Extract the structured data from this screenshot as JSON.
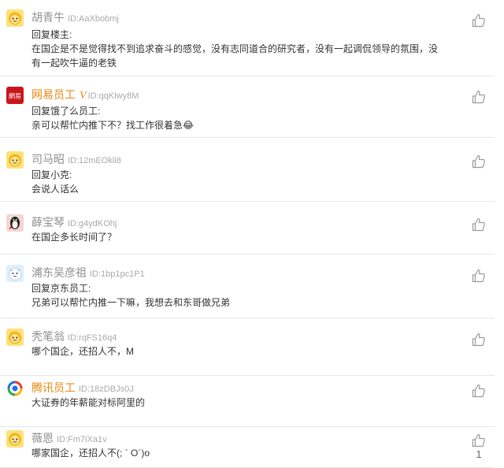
{
  "comments": [
    {
      "name": "胡青牛",
      "id": "ID:AaXbobmj",
      "avatar": "yellow-face",
      "official": false,
      "lines": [
        "回复楼主:",
        "在国企是不是觉得找不到追求奋斗的感觉，没有志同道合的研究者，没有一起调侃领导的氛围，没",
        "有一起吹牛逼的老铁"
      ]
    },
    {
      "name": "网易员工",
      "verified": "V",
      "id": "ID:qqKlwy8M",
      "avatar": "netease-logo",
      "avatar_text": "網易",
      "official": true,
      "lines": [
        "回复饿了么员工:",
        "亲可以帮忙内推下不？找工作很着急😂"
      ]
    },
    {
      "name": "司马昭",
      "id": "ID:12mEOkli8",
      "avatar": "yellow-face",
      "official": false,
      "lines": [
        "回复小克:",
        "会说人话么"
      ]
    },
    {
      "name": "薛宝琴",
      "id": "ID:g4ydKOhj",
      "avatar": "penguin",
      "official": false,
      "lines": [
        "在国企多长时间了？"
      ]
    },
    {
      "name": "浦东吴彦祖",
      "id": "ID:1bp1pc1P1",
      "avatar": "snow-face",
      "official": false,
      "lines": [
        "回复京东员工:",
        "兄弟可以帮忙内推一下嘛，我想去和东哥做兄弟"
      ]
    },
    {
      "name": "秃笔翁",
      "id": "ID:rqFS16q4",
      "avatar": "yellow-face",
      "official": false,
      "lines": [
        "哪个国企，还招人不，M"
      ]
    },
    {
      "name": "腾讯员工",
      "id": "ID:18zDBJs0J",
      "avatar": "tencent-logo",
      "official": true,
      "lines": [
        "大证券的年薪能对标阿里的"
      ]
    },
    {
      "name": "薇恩",
      "id": "ID:Fm7iXa1v",
      "avatar": "yellow-face",
      "official": false,
      "lines": [
        "哪家国企，还招人不(; ` O´)o"
      ],
      "likes": "1"
    }
  ],
  "icons": {
    "like": "thumbs-up-icon"
  },
  "colors": {
    "official_name": "#e8870f",
    "name": "#8f8f8f",
    "id": "#a9a9a9",
    "divider": "#e6e6e6",
    "text": "#333333"
  }
}
